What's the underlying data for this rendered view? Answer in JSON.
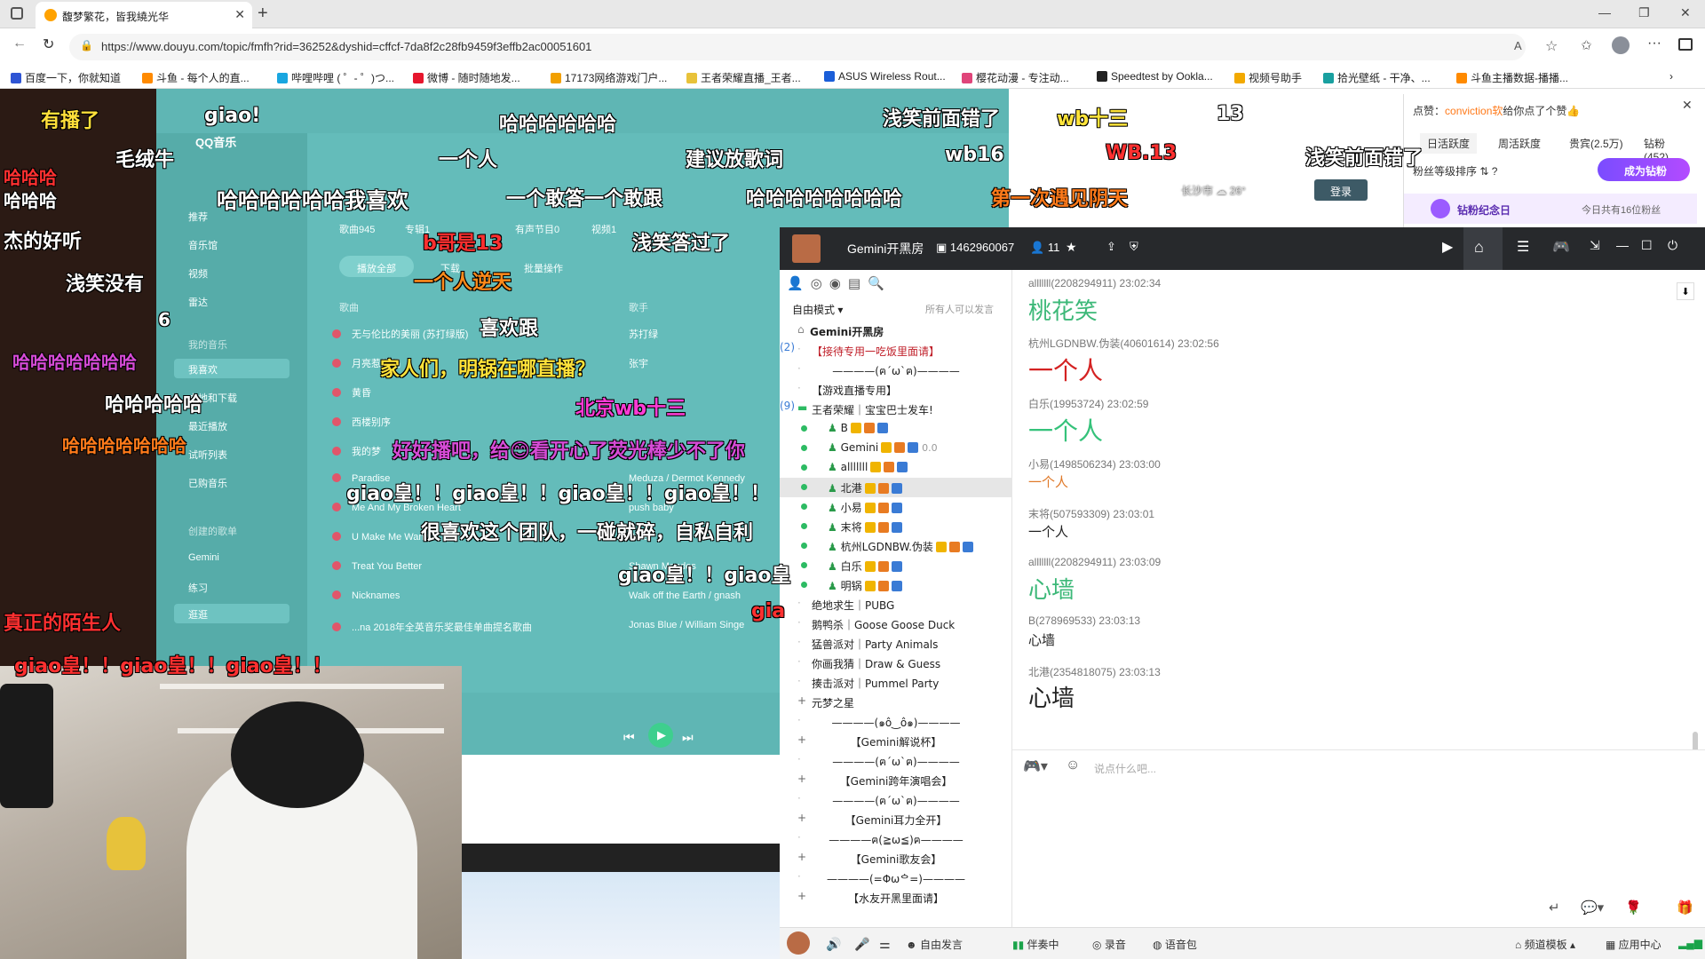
{
  "browser": {
    "tab_title": "馥梦繁花，皆我繞光华",
    "url": "https://www.douyu.com/topic/fmfh?rid=36252&dyshid=cffcf-7da8f2c28fb9459f3effb2ac00051601",
    "bookmarks": [
      "百度一下，你就知道",
      "斗鱼 - 每个人的直...",
      "哔哩哔哩 ( ゜- ゜)つ...",
      "微博 - 随时随地发...",
      "17173网络游戏门户...",
      "王者荣耀直播_王者...",
      "ASUS Wireless Rout...",
      "樱花动漫 - 专注动...",
      "Speedtest by Ookla...",
      "视频号助手",
      "拾光壁纸 - 干净、...",
      "斗鱼主播数据-播播..."
    ]
  },
  "music_app": {
    "name": "QQ音乐",
    "sidebar": [
      "推荐",
      "音乐馆",
      "视频",
      "雷达",
      "我的音乐",
      "我喜欢",
      "本地和下载",
      "最近播放",
      "试听列表",
      "已购音乐",
      "创建的歌单",
      "Gemini",
      "练习",
      "逛逛"
    ],
    "tabs": [
      "歌曲945",
      "专辑1",
      "有声节目0",
      "视频1"
    ],
    "buttons": [
      "播放全部",
      "下载",
      "批量操作"
    ],
    "col_song": "歌曲",
    "col_singer": "歌手",
    "songs": [
      {
        "title": "无与伦比的美丽 (苏打绿版)",
        "singer": "苏打绿"
      },
      {
        "title": "月亮惹的祸",
        "singer": "张宇"
      },
      {
        "title": "黄昏",
        "singer": ""
      },
      {
        "title": "西楼别序",
        "singer": ""
      },
      {
        "title": "我的梦",
        "singer": ""
      },
      {
        "title": "Paradise",
        "singer": "Meduza / Dermot Kennedy"
      },
      {
        "title": "Me And My Broken Heart",
        "singer": "push baby"
      },
      {
        "title": "U Make Me Wanna",
        "singer": "Blue"
      },
      {
        "title": "Treat You Better",
        "singer": "Shawn Mendes"
      },
      {
        "title": "Nicknames",
        "singer": "Walk off the Earth / gnash"
      },
      {
        "title": "...na 2018年全英音乐奖最佳单曲提名歌曲",
        "singer": "Jonas Blue / William Singe"
      }
    ]
  },
  "fan_panel": {
    "notice_prefix": "点赞：",
    "notice_user": "conviction软",
    "notice_suffix": "给你点了个赞",
    "tabs": [
      "日活跃度",
      "周活跃度",
      "贵宾(2.5万)",
      "钻粉(452)"
    ],
    "rank_label": "粉丝等级排序",
    "become_button": "成为钻粉",
    "anniversary": "钻粉纪念日",
    "today_text": "今日共有16位粉丝",
    "login": "登录",
    "city": "长沙市",
    "temp": "26°"
  },
  "gemini": {
    "room_name": "Gemini开黑房",
    "room_id": "1462960067",
    "online": "11",
    "mode": "自由模式",
    "mode_hint": "所有人可以发言",
    "channels": [
      {
        "type": "root",
        "name": "Gemini开黑房"
      },
      {
        "type": "channel",
        "name": "【接待专用一吃饭里面请】",
        "count": "(2)",
        "color": "#c0202a"
      },
      {
        "type": "divider",
        "name": "————(ฅ´ω`ฅ)————"
      },
      {
        "type": "channel",
        "name": "【游戏直播专用】",
        "count": "",
        "color": "#222"
      },
      {
        "type": "open",
        "name": "王者荣耀｜宝宝巴士发车!",
        "count": "(9)",
        "color": "#222"
      },
      {
        "type": "user",
        "name": "B"
      },
      {
        "type": "user",
        "name": "Gemini",
        "extra": "0.0"
      },
      {
        "type": "user",
        "name": "alllllll"
      },
      {
        "type": "user",
        "name": "北港",
        "selected": true
      },
      {
        "type": "user",
        "name": "小易"
      },
      {
        "type": "user",
        "name": "末将"
      },
      {
        "type": "user",
        "name": "杭州LGDNBW.伪装"
      },
      {
        "type": "user",
        "name": "白乐"
      },
      {
        "type": "user",
        "name": "明锅"
      },
      {
        "type": "channel",
        "name": "绝地求生｜PUBG",
        "count": "",
        "color": "#222"
      },
      {
        "type": "channel",
        "name": "鹅鸭杀｜Goose Goose Duck",
        "count": "",
        "color": "#222"
      },
      {
        "type": "channel",
        "name": "猛兽派对｜Party Animals",
        "count": "",
        "color": "#222"
      },
      {
        "type": "channel",
        "name": "你画我猜｜Draw & Guess",
        "count": "",
        "color": "#222"
      },
      {
        "type": "channel",
        "name": "揍击派对｜Pummel Party",
        "count": "",
        "color": "#222"
      },
      {
        "type": "plus",
        "name": "元梦之星"
      },
      {
        "type": "divider",
        "name": "————(๑ô‿ô๑)————"
      },
      {
        "type": "pluscenter",
        "name": "【Gemini解说杯】"
      },
      {
        "type": "divider",
        "name": "————(ฅ´ω`ฅ)————"
      },
      {
        "type": "pluscenter",
        "name": "【Gemini跨年演唱会】"
      },
      {
        "type": "divider",
        "name": "————(ฅ´ω`ฅ)————"
      },
      {
        "type": "pluscenter",
        "name": "【Gemini耳力全开】"
      },
      {
        "type": "divider",
        "name": "————ฅ(≧ω≦)ฅ————"
      },
      {
        "type": "pluscenter",
        "name": "【Gemini歌友会】"
      },
      {
        "type": "divider",
        "name": "————(=Φωᅌ=)————"
      },
      {
        "type": "pluscenter",
        "name": "【水友开黑里面请】"
      }
    ],
    "messages": [
      {
        "user": "alllllll(2208294911)",
        "time": "23:02:34",
        "text": "桃花笑",
        "color": "#3cb878",
        "size": 26
      },
      {
        "user": "杭州LGDNBW.伪装(40601614)",
        "time": "23:02:56",
        "text": "一个人",
        "color": "#d42222",
        "size": 28
      },
      {
        "user": "白乐(19953724)",
        "time": "23:02:59",
        "text": "一个人",
        "color": "#35c27a",
        "size": 28
      },
      {
        "user": "小易(1498506234)",
        "time": "23:03:00",
        "text": "一个人",
        "color": "#e07a2a",
        "size": 15
      },
      {
        "user": "末将(507593309)",
        "time": "23:03:01",
        "text": "一个人",
        "color": "#222222",
        "size": 15
      },
      {
        "user": "alllllll(2208294911)",
        "time": "23:03:09",
        "text": "心墙",
        "color": "#3cb878",
        "size": 26
      },
      {
        "user": "B(278969533)",
        "time": "23:03:13",
        "text": "心墙",
        "color": "#222222",
        "size": 15
      },
      {
        "user": "北港(2354818075)",
        "time": "23:03:13",
        "text": "心墙",
        "color": "#222222",
        "size": 26
      }
    ],
    "input_placeholder": "说点什么吧...",
    "bottom": [
      "自由发言",
      "伴奏中",
      "录音",
      "语音包",
      "频道模板",
      "应用中心"
    ]
  },
  "danmaku": [
    {
      "text": "有播了",
      "color": "#ffdf3a"
    },
    {
      "text": "giao!",
      "color": "#ffffff"
    },
    {
      "text": "哈哈哈哈哈哈",
      "color": "#ffffff"
    },
    {
      "text": "浅笑前面错了",
      "color": "#ffffff"
    },
    {
      "text": "wb十三",
      "color": "#ffe43a"
    },
    {
      "text": "13",
      "color": "#ffffff"
    },
    {
      "text": "毛绒牛",
      "color": "#ffffff"
    },
    {
      "text": "一个人",
      "color": "#ffffff"
    },
    {
      "text": "建议放歌词",
      "color": "#ffffff"
    },
    {
      "text": "wb16",
      "color": "#ffffff"
    },
    {
      "text": "WB.13",
      "color": "#ff3030"
    },
    {
      "text": "浅笑前面错了",
      "color": "#ffffff"
    },
    {
      "text": "哈哈哈哈哈哈我喜欢",
      "color": "#ffffff"
    },
    {
      "text": "一个敢答一个敢跟",
      "color": "#ffffff"
    },
    {
      "text": "哈哈哈哈哈哈哈哈",
      "color": "#ffffff"
    },
    {
      "text": "第一次遇见阴天",
      "color": "#ff7a1a"
    },
    {
      "text": "哈哈哈",
      "color": "#ff3030"
    },
    {
      "text": "哈哈哈",
      "color": "#ffffff"
    },
    {
      "text": "杰的好听",
      "color": "#ffffff"
    },
    {
      "text": "b哥是13",
      "color": "#ff3030"
    },
    {
      "text": "浅笑答过了",
      "color": "#ffffff"
    },
    {
      "text": "浅笑没有",
      "color": "#ffffff"
    },
    {
      "text": "一个人逆天",
      "color": "#ff8a1a"
    },
    {
      "text": "6",
      "color": "#ffffff"
    },
    {
      "text": "喜欢跟",
      "color": "#ffffff"
    },
    {
      "text": "哈哈哈哈哈哈哈",
      "color": "#d64bd6"
    },
    {
      "text": "家人们，明锅在哪直播？",
      "color": "#ffe23a"
    },
    {
      "text": "哈哈哈哈哈",
      "color": "#ffffff"
    },
    {
      "text": "北京wb十三",
      "color": "#ff3bd6"
    },
    {
      "text": "哈哈哈哈哈哈哈",
      "color": "#ff7a1a"
    },
    {
      "text": "好好播吧，给😊看开心了荧光棒少不了你",
      "color": "#d64bd6"
    },
    {
      "text": "giao皇！！giao皇！！giao皇！！giao皇！！",
      "color": "#ffffff"
    },
    {
      "text": "很喜欢这个团队，一碰就碎，自私自利",
      "color": "#ffffff"
    },
    {
      "text": "giao皇！！giao皇",
      "color": "#ffffff"
    },
    {
      "text": "gia",
      "color": "#ff3030"
    },
    {
      "text": "真正的陌生人",
      "color": "#ff3030"
    },
    {
      "text": "giao皇！！giao皇！！giao皇！！",
      "color": "#ff3030"
    }
  ]
}
